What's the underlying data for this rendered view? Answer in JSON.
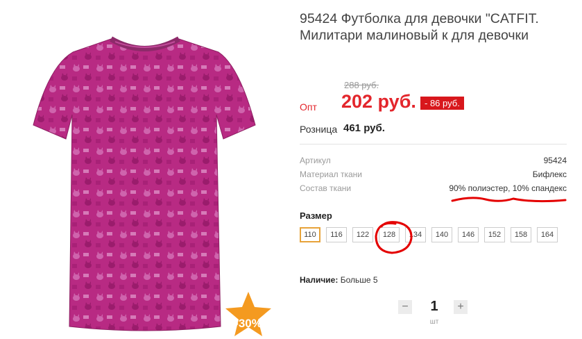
{
  "product": {
    "title": "95424 Футболка для девочки \"CATFIT. Милитари малиновый к для девочки",
    "image_alt": "Малиновая футболка с кошачьим принтом",
    "badge": "-30%"
  },
  "price": {
    "old": "288 руб.",
    "opt_label": "Опт",
    "opt_value": "202 руб.",
    "discount": "- 86 руб.",
    "retail_label": "Розница",
    "retail_value": "461 руб."
  },
  "properties": [
    {
      "key": "Артикул",
      "value": "95424"
    },
    {
      "key": "Материал ткани",
      "value": "Бифлекс"
    },
    {
      "key": "Состав ткани",
      "value": "90% полиэстер, 10% спандекс"
    }
  ],
  "sizes": {
    "title": "Размер",
    "options": [
      "110",
      "116",
      "122",
      "128",
      "134",
      "140",
      "146",
      "152",
      "158",
      "164"
    ],
    "selected": "110"
  },
  "availability": {
    "label": "Наличие:",
    "value": "Больше 5"
  },
  "quantity": {
    "minus": "−",
    "value": "1",
    "plus": "+",
    "unit": "шт"
  },
  "colors": {
    "accent_red": "#e3262c",
    "selected_border": "#e7a33a",
    "shirt": "#b6267f",
    "badge": "#f49a20"
  }
}
